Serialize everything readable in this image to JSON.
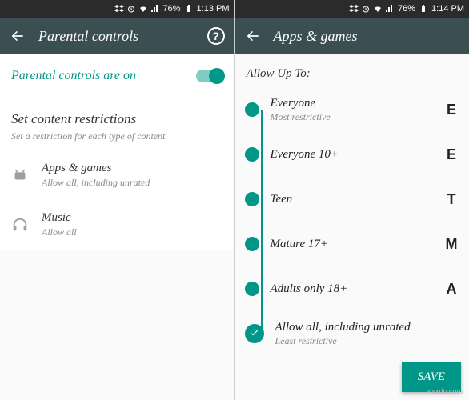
{
  "left": {
    "status": {
      "battery": "76%",
      "time": "1:13 PM"
    },
    "appbar": {
      "title": "Parental controls"
    },
    "toggle": {
      "label": "Parental controls are on",
      "on": true
    },
    "section": {
      "title": "Set content restrictions",
      "subtitle": "Set a restriction for each type of content"
    },
    "items": [
      {
        "title": "Apps & games",
        "subtitle": "Allow all, including unrated"
      },
      {
        "title": "Music",
        "subtitle": "Allow all"
      }
    ]
  },
  "right": {
    "status": {
      "battery": "76%",
      "time": "1:14 PM"
    },
    "appbar": {
      "title": "Apps & games"
    },
    "allow_label": "Allow Up To:",
    "ratings": [
      {
        "label": "Everyone",
        "sub": "Most restrictive",
        "badge": "E"
      },
      {
        "label": "Everyone 10+",
        "sub": "",
        "badge": "E"
      },
      {
        "label": "Teen",
        "sub": "",
        "badge": "T"
      },
      {
        "label": "Mature 17+",
        "sub": "",
        "badge": "M"
      },
      {
        "label": "Adults only 18+",
        "sub": "",
        "badge": "A"
      },
      {
        "label": "Allow all, including unrated",
        "sub": "Least restrictive",
        "badge": "",
        "checked": true
      }
    ],
    "save": "SAVE"
  },
  "watermark": "wsxdn.com"
}
